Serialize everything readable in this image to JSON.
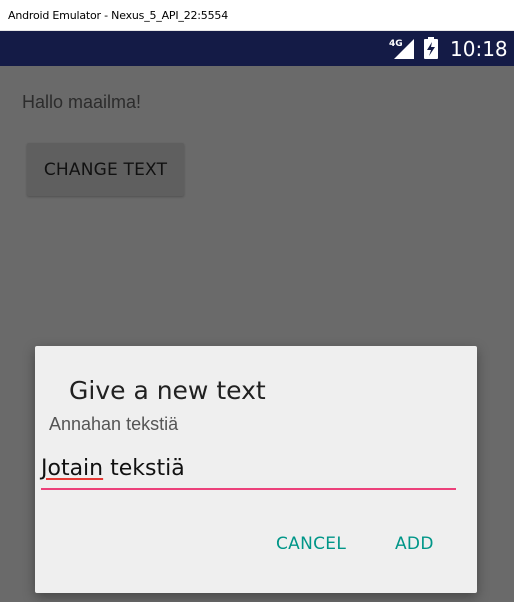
{
  "window": {
    "title": "Android Emulator - Nexus_5_API_22:5554"
  },
  "status_bar": {
    "network_label": "4G",
    "time": "10:18",
    "icons": [
      "signal-icon",
      "battery-icon"
    ]
  },
  "app": {
    "hello_text": "Hallo maailma!",
    "change_button_label": "CHANGE TEXT"
  },
  "dialog": {
    "title": "Give a new text",
    "message": "Annahan tekstiä",
    "input_value_word1": "Jotain",
    "input_value_word2": " tekstiä",
    "cancel_label": "CANCEL",
    "add_label": "ADD"
  },
  "colors": {
    "status_bar": "#141b46",
    "accent_underline": "#ec407a",
    "dialog_button": "#009688",
    "spellcheck": "#e53935"
  }
}
